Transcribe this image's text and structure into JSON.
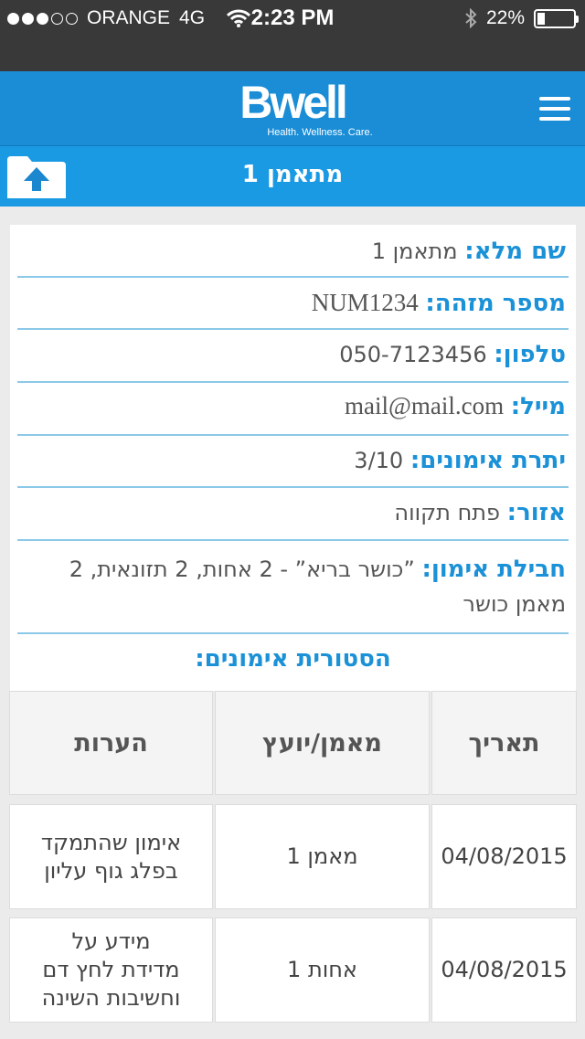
{
  "status_bar": {
    "carrier": "ORANGE",
    "network": "4G",
    "time": "2:23 PM",
    "battery_percent": "22%",
    "signal_bars_filled": 3,
    "signal_bars_total": 5
  },
  "header": {
    "logo_word": "Bwell",
    "logo_tagline": "Health. Wellness. Care."
  },
  "title_bar": {
    "title": "מתאמן 1"
  },
  "profile": {
    "full_name_label": "שם מלא:",
    "full_name_value": "מתאמן 1",
    "id_label": "מספר מזהה:",
    "id_value": "NUM1234",
    "phone_label": "טלפון:",
    "phone_value": "050-7123456",
    "email_label": "מייל:",
    "email_value": "mail@mail.com",
    "sessions_left_label": "יתרת אימונים:",
    "sessions_left_value": "3/10",
    "area_label": "אזור:",
    "area_value": "פתח תקווה",
    "package_label": "חבילת אימון:",
    "package_value": "”כושר בריא” - 2 אחות, 2 תזונאית, 2 מאמן כושר"
  },
  "history": {
    "title": "הסטורית אימונים:",
    "columns": [
      "תאריך",
      "מאמן/יועץ",
      "הערות"
    ],
    "rows": [
      {
        "date": "04/08/2015",
        "trainer": "מאמן 1",
        "notes": "אימון שהתמקד\nבפלג גוף עליון"
      },
      {
        "date": "04/08/2015",
        "trainer": "אחות 1",
        "notes": "מידע על\nמדידת לחץ דם\nוחשיבות השינה"
      }
    ]
  },
  "colors": {
    "header_blue": "#1a8dd6",
    "title_blue": "#1b9ae4",
    "label_blue": "#1b91d8",
    "status_bar": "#393939"
  }
}
